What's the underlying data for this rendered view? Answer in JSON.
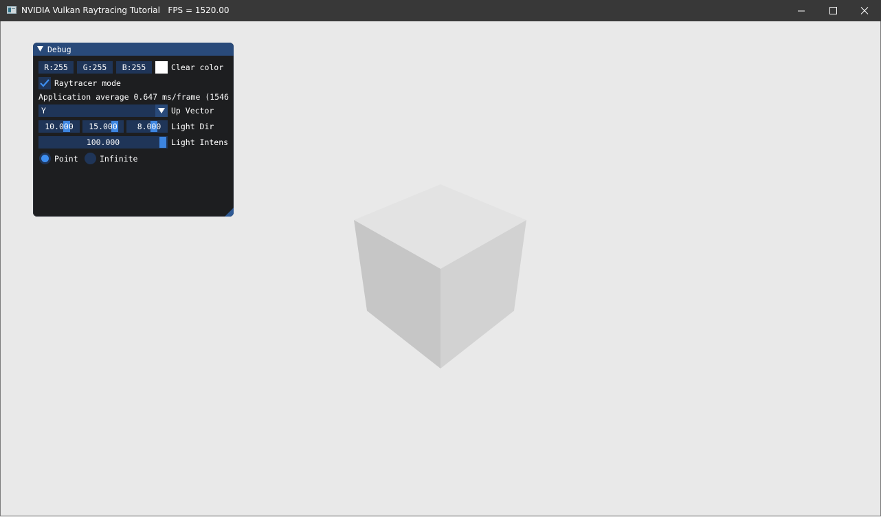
{
  "window": {
    "title": "NVIDIA Vulkan Raytracing Tutorial   FPS = 1520.00"
  },
  "debug_panel": {
    "title": "Debug",
    "color_fields": [
      "R:255",
      "G:255",
      "B:255"
    ],
    "clear_color_label": "Clear color",
    "clear_color_value": "#ffffff",
    "raytracer_label": "Raytracer mode",
    "raytracer_checked": true,
    "app_average_text": "Application average 0.647 ms/frame (1546",
    "up_vector": {
      "value": "Y",
      "label": "Up Vector"
    },
    "light_dir": {
      "values": [
        "10.000",
        "15.000",
        "8.000"
      ],
      "label": "Light Dir"
    },
    "light_intensity": {
      "value": "100.000",
      "label": "Light Intens"
    },
    "light_type": {
      "options": [
        "Point",
        "Infinite"
      ],
      "selected": "Point"
    }
  },
  "colors": {
    "titlebar": "#383838",
    "panel_bg": "#1d1e20",
    "panel_header": "#294a7a",
    "widget_bg": "#1f3558",
    "accent": "#3d85e0",
    "viewport": "#e9e9e9"
  }
}
